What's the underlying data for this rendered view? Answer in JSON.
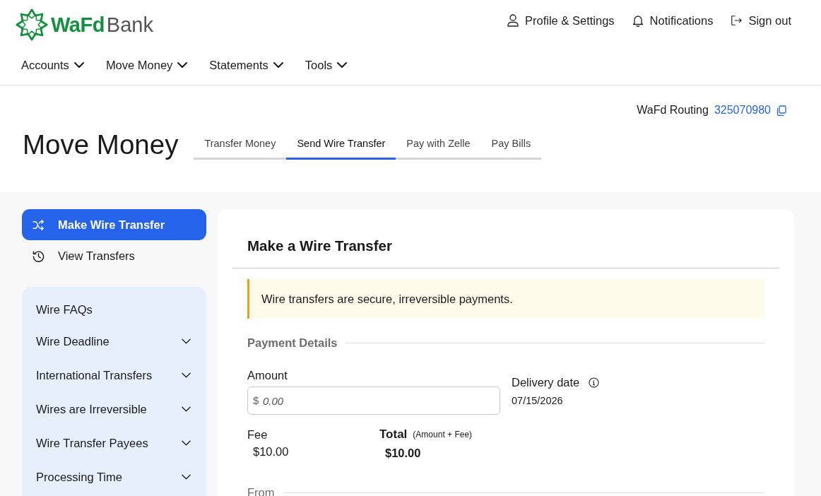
{
  "header": {
    "logo": {
      "brand": "WaFd",
      "suffix": "Bank"
    },
    "utility_links": [
      {
        "kind": "profile",
        "label": "Profile & Settings"
      },
      {
        "kind": "notifications",
        "label": "Notifications"
      },
      {
        "kind": "sign_out",
        "label": "Sign out"
      }
    ],
    "nav": [
      {
        "label": "Accounts"
      },
      {
        "label": "Move Money"
      },
      {
        "label": "Statements"
      },
      {
        "label": "Tools"
      }
    ]
  },
  "routing": {
    "label": "WaFd Routing",
    "number": "325070980"
  },
  "page_title": "Move Money",
  "tabs": [
    {
      "label": "Transfer Money",
      "selected": false
    },
    {
      "label": "Send Wire Transfer",
      "selected": true
    },
    {
      "label": "Pay with Zelle",
      "selected": false
    },
    {
      "label": "Pay Bills",
      "selected": false
    }
  ],
  "sidebar": {
    "actions": [
      {
        "kind": "new_wire",
        "label": "Make Wire Transfer",
        "selected": true
      },
      {
        "kind": "history",
        "label": "View Transfers",
        "selected": false
      }
    ],
    "faq": {
      "title": "Wire FAQs",
      "items": [
        {
          "label": "Wire Deadline",
          "expanded": false
        },
        {
          "label": "International Transfers",
          "expanded": false
        },
        {
          "label": "Wires are Irreversible",
          "expanded": false
        },
        {
          "label": "Wire Transfer Payees",
          "expanded": false
        },
        {
          "label": "Processing Time",
          "expanded": false
        }
      ]
    }
  },
  "wire_form": {
    "title": "Make a Wire Transfer",
    "notice": "Wire transfers are secure, irreversible payments.",
    "payment_details": {
      "heading": "Payment Details",
      "amount": {
        "label": "Amount",
        "prefix": "$",
        "placeholder": "0.00"
      },
      "delivery_date": {
        "label": "Delivery date",
        "value": "07/15/2026"
      },
      "fee": {
        "label": "Fee",
        "value": "$10.00"
      },
      "total": {
        "label": "Total",
        "note": "(Amount + Fee)",
        "value": "$10.00"
      }
    },
    "next_section": {
      "heading": "From"
    }
  }
}
